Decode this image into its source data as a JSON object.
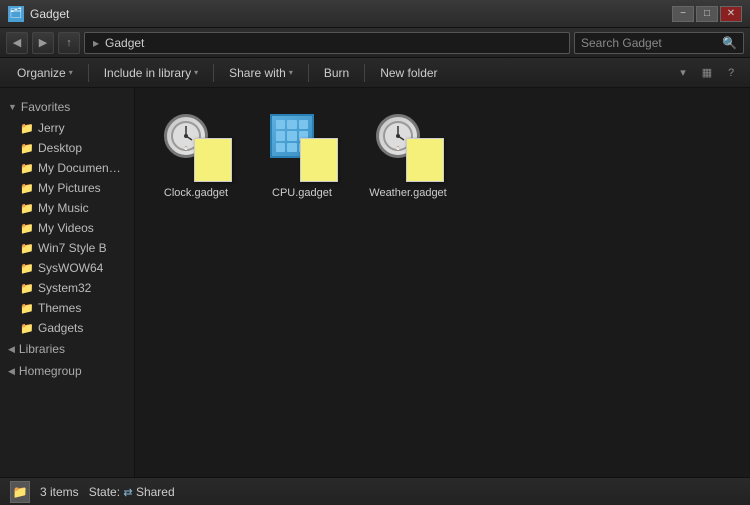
{
  "titleBar": {
    "title": "Gadget",
    "icon": "🗂",
    "minimizeLabel": "−",
    "maximizeLabel": "□",
    "closeLabel": "✕"
  },
  "navBar": {
    "backArrow": "◀",
    "forwardArrow": "▶",
    "upArrow": "↑",
    "addressPath": "Gadget",
    "searchPlaceholder": "Search Gadget",
    "searchIcon": "🔍"
  },
  "toolbar": {
    "organizeLabel": "Organize",
    "includeLabel": "Include in library",
    "shareLabel": "Share with",
    "burnLabel": "Burn",
    "newFolderLabel": "New folder",
    "viewDropdownIcon": "▾",
    "gridViewIcon": "▦",
    "helpIcon": "?"
  },
  "sidebar": {
    "favoritesLabel": "Favorites",
    "favoritesArrow": "▼",
    "items": [
      {
        "label": "Jerry",
        "icon": "📁"
      },
      {
        "label": "Desktop",
        "icon": "📁"
      },
      {
        "label": "My Documen…",
        "icon": "📁"
      },
      {
        "label": "My Pictures",
        "icon": "📁"
      },
      {
        "label": "My Music",
        "icon": "📁"
      },
      {
        "label": "My Videos",
        "icon": "📁"
      },
      {
        "label": "Win7 Style B",
        "icon": "📁"
      },
      {
        "label": "SysWOW64",
        "icon": "📁"
      },
      {
        "label": "System32",
        "icon": "📁"
      },
      {
        "label": "Themes",
        "icon": "📁"
      },
      {
        "label": "Gadgets",
        "icon": "📁"
      }
    ],
    "librariesLabel": "Libraries",
    "librariesArrow": "◀",
    "homegroupLabel": "Homegroup",
    "homegroupArrow": "◀"
  },
  "files": [
    {
      "name": "Clock.gadget",
      "type": "clock"
    },
    {
      "name": "CPU.gadget",
      "type": "cpu"
    },
    {
      "name": "Weather.gadget",
      "type": "weather"
    }
  ],
  "statusBar": {
    "itemCount": "3 items",
    "stateLabel": "State:",
    "sharedLabel": "Shared",
    "sharedIcon": "⇄"
  }
}
